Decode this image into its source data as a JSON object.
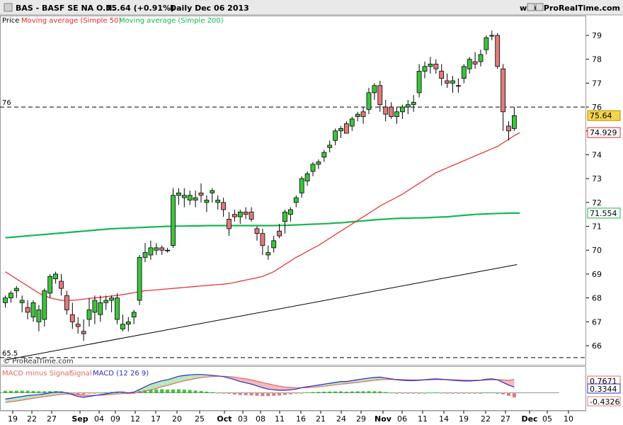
{
  "header": {
    "symbol": "BAS - BASF SE NA O.N.",
    "quote": "75.64 (+0.91%)",
    "period": "Daily  Dec 06 2013",
    "site": "www.ProRealTime.com"
  },
  "legend": {
    "price": "Price",
    "ma50": "Moving average (Simple 50)",
    "ma200": "Moving average (Simple 200)"
  },
  "macd_legend": {
    "hist": "MACD minus Signal",
    "signal": "Signal",
    "macd": "MACD (12 26 9)"
  },
  "copyright": "© ProRealTime.com",
  "colors": {
    "up": "#3cc43c",
    "down": "#e07b7b",
    "ma50": "#e8262a",
    "ma200": "#14b850",
    "macd": "#2a2acc",
    "signal": "#e06a6a",
    "price_tag": "#f6d34a"
  },
  "chart_data": {
    "type": "candlestick",
    "ylim": [
      65.4,
      79.5
    ],
    "y_ticks": [
      "79",
      "78",
      "77",
      "76",
      "75",
      "74",
      "73",
      "72",
      "71",
      "70",
      "69",
      "68",
      "67",
      "66"
    ],
    "x_ticks": [
      "19",
      "22",
      "27",
      "Sep",
      "04",
      "09",
      "12",
      "17",
      "20",
      "25",
      "Oct",
      "03",
      "08",
      "11",
      "16",
      "21",
      "24",
      "29",
      "Nov",
      "06",
      "11",
      "14",
      "19",
      "22",
      "27",
      "Dec",
      "05",
      "10"
    ],
    "h_lines": [
      {
        "label": "76",
        "value": 76.0
      },
      {
        "label": "65.5",
        "value": 65.5
      }
    ],
    "tags": {
      "last": "75.64",
      "ma50": "74.929",
      "ma200": "71.554"
    },
    "candles": [
      [
        67.8,
        68.1,
        67.6,
        68.0
      ],
      [
        68.0,
        68.3,
        67.8,
        68.2
      ],
      [
        68.3,
        68.5,
        68.0,
        68.4
      ],
      [
        67.8,
        68.1,
        67.4,
        67.9
      ],
      [
        67.6,
        67.9,
        67.1,
        67.4
      ],
      [
        67.2,
        67.9,
        67.0,
        67.8
      ],
      [
        67.0,
        67.7,
        66.6,
        67.5
      ],
      [
        67.1,
        68.4,
        66.8,
        68.3
      ],
      [
        68.2,
        69.0,
        68.0,
        68.9
      ],
      [
        68.8,
        69.1,
        68.6,
        69.0
      ],
      [
        68.7,
        69.0,
        68.1,
        68.4
      ],
      [
        68.1,
        68.3,
        67.3,
        67.5
      ],
      [
        67.3,
        67.8,
        66.7,
        67.0
      ],
      [
        66.9,
        67.2,
        66.5,
        66.8
      ],
      [
        66.6,
        67.1,
        66.2,
        66.5
      ],
      [
        67.1,
        68.0,
        66.8,
        67.5
      ],
      [
        67.4,
        68.1,
        66.9,
        67.9
      ],
      [
        67.3,
        68.1,
        67.0,
        67.8
      ],
      [
        67.8,
        68.1,
        67.5,
        67.9
      ],
      [
        67.9,
        68.1,
        67.4,
        68.0
      ],
      [
        67.1,
        68.2,
        66.9,
        68.0
      ],
      [
        66.7,
        67.3,
        66.6,
        66.9
      ],
      [
        66.9,
        67.2,
        66.6,
        67.0
      ],
      [
        67.2,
        67.5,
        66.9,
        67.4
      ],
      [
        67.9,
        69.8,
        67.7,
        69.7
      ],
      [
        69.7,
        70.3,
        69.5,
        69.9
      ],
      [
        69.8,
        70.4,
        69.6,
        70.1
      ],
      [
        70.0,
        70.3,
        69.8,
        70.1
      ],
      [
        70.1,
        70.2,
        69.8,
        70.0
      ],
      [
        70.0,
        70.1,
        69.9,
        70.0
      ],
      [
        70.2,
        72.6,
        70.1,
        72.3
      ],
      [
        72.3,
        72.6,
        71.9,
        72.4
      ],
      [
        72.2,
        72.6,
        71.8,
        72.3
      ],
      [
        72.1,
        72.5,
        71.9,
        72.3
      ],
      [
        72.1,
        72.5,
        71.8,
        72.2
      ],
      [
        72.4,
        72.8,
        72.0,
        72.3
      ],
      [
        72.0,
        72.3,
        71.6,
        72.1
      ],
      [
        72.4,
        72.6,
        72.0,
        72.5
      ],
      [
        72.0,
        72.3,
        71.7,
        72.1
      ],
      [
        72.0,
        72.2,
        71.4,
        71.7
      ],
      [
        71.3,
        71.6,
        70.6,
        70.9
      ],
      [
        71.5,
        71.7,
        71.2,
        71.4
      ],
      [
        71.4,
        71.7,
        71.1,
        71.6
      ],
      [
        71.6,
        71.8,
        71.3,
        71.5
      ],
      [
        71.6,
        71.8,
        71.2,
        71.3
      ],
      [
        70.9,
        71.0,
        70.4,
        70.7
      ],
      [
        70.7,
        70.9,
        69.8,
        70.2
      ],
      [
        69.8,
        70.2,
        69.6,
        69.9
      ],
      [
        70.1,
        70.6,
        69.9,
        70.4
      ],
      [
        70.8,
        71.1,
        70.5,
        70.6
      ],
      [
        71.2,
        71.7,
        70.7,
        71.6
      ],
      [
        71.5,
        71.8,
        71.2,
        71.7
      ],
      [
        72.0,
        72.3,
        71.8,
        72.2
      ],
      [
        72.4,
        73.1,
        72.2,
        73.0
      ],
      [
        72.9,
        73.3,
        72.7,
        73.2
      ],
      [
        73.3,
        73.7,
        73.1,
        73.6
      ],
      [
        73.6,
        73.8,
        73.4,
        73.7
      ],
      [
        73.9,
        74.2,
        73.7,
        74.1
      ],
      [
        74.3,
        74.6,
        74.1,
        74.4
      ],
      [
        74.6,
        75.1,
        74.4,
        75.0
      ],
      [
        75.0,
        75.2,
        74.7,
        75.1
      ],
      [
        75.3,
        75.4,
        74.9,
        74.9
      ],
      [
        75.2,
        75.6,
        75.0,
        75.5
      ],
      [
        75.6,
        75.8,
        75.4,
        75.7
      ],
      [
        75.8,
        76.0,
        75.3,
        75.6
      ],
      [
        75.9,
        76.8,
        75.7,
        76.6
      ],
      [
        76.6,
        77.0,
        76.3,
        76.9
      ],
      [
        76.9,
        77.1,
        75.8,
        76.1
      ],
      [
        76.0,
        76.3,
        75.4,
        75.7
      ],
      [
        76.0,
        76.2,
        75.5,
        75.6
      ],
      [
        75.6,
        76.0,
        75.3,
        75.8
      ],
      [
        75.8,
        76.1,
        75.5,
        76.0
      ],
      [
        76.0,
        76.3,
        75.7,
        76.1
      ],
      [
        76.1,
        76.5,
        75.8,
        76.2
      ],
      [
        76.6,
        77.8,
        76.4,
        77.5
      ],
      [
        77.5,
        77.9,
        77.2,
        77.7
      ],
      [
        77.7,
        78.1,
        77.4,
        77.8
      ],
      [
        77.8,
        78.0,
        77.4,
        77.6
      ],
      [
        77.5,
        77.8,
        76.9,
        77.2
      ],
      [
        77.1,
        77.4,
        76.8,
        77.0
      ],
      [
        77.0,
        77.3,
        76.6,
        77.1
      ],
      [
        76.9,
        77.2,
        76.6,
        76.9
      ],
      [
        77.2,
        77.8,
        77.0,
        77.7
      ],
      [
        77.6,
        78.1,
        77.4,
        78.0
      ],
      [
        77.9,
        78.3,
        77.6,
        77.8
      ],
      [
        77.9,
        78.4,
        77.7,
        78.2
      ],
      [
        78.4,
        79.0,
        78.2,
        78.9
      ],
      [
        79.0,
        79.2,
        78.8,
        79.0
      ],
      [
        79.0,
        79.1,
        77.6,
        77.7
      ],
      [
        77.6,
        77.8,
        75.0,
        75.8
      ],
      [
        75.2,
        75.4,
        74.6,
        75.0
      ],
      [
        75.1,
        76.0,
        75.0,
        75.64
      ]
    ],
    "ma50": [
      69.1,
      68.95,
      68.8,
      68.65,
      68.5,
      68.35,
      68.2,
      68.1,
      68.0,
      67.95,
      67.9,
      67.9,
      67.9,
      67.92,
      67.95,
      67.98,
      68.0,
      68.02,
      68.05,
      68.08,
      68.1,
      68.14,
      68.18,
      68.22,
      68.26,
      68.3,
      68.32,
      68.34,
      68.36,
      68.38,
      68.4,
      68.42,
      68.44,
      68.46,
      68.48,
      68.5,
      68.52,
      68.54,
      68.56,
      68.58,
      68.6,
      68.65,
      68.7,
      68.75,
      68.8,
      68.85,
      68.9,
      69.0,
      69.1,
      69.25,
      69.4,
      69.55,
      69.7,
      69.82,
      69.95,
      70.08,
      70.2,
      70.35,
      70.5,
      70.65,
      70.8,
      70.95,
      71.1,
      71.25,
      71.4,
      71.55,
      71.7,
      71.85,
      71.98,
      72.1,
      72.22,
      72.35,
      72.5,
      72.65,
      72.8,
      72.95,
      73.1,
      73.25,
      73.35,
      73.45,
      73.55,
      73.65,
      73.75,
      73.85,
      73.95,
      74.05,
      74.15,
      74.25,
      74.35,
      74.5,
      74.65,
      74.8,
      74.929
    ],
    "ma200": [
      70.52,
      70.54,
      70.56,
      70.58,
      70.6,
      70.62,
      70.64,
      70.66,
      70.68,
      70.7,
      70.72,
      70.74,
      70.76,
      70.78,
      70.8,
      70.82,
      70.84,
      70.86,
      70.88,
      70.9,
      70.91,
      70.92,
      70.93,
      70.94,
      70.95,
      70.96,
      70.97,
      70.98,
      70.99,
      71.0,
      71.0,
      71.01,
      71.01,
      71.02,
      71.02,
      71.02,
      71.03,
      71.03,
      71.03,
      71.03,
      71.03,
      71.03,
      71.03,
      71.03,
      71.03,
      71.03,
      71.03,
      71.03,
      71.03,
      71.04,
      71.04,
      71.05,
      71.06,
      71.07,
      71.08,
      71.09,
      71.1,
      71.11,
      71.12,
      71.14,
      71.15,
      71.17,
      71.19,
      71.21,
      71.23,
      71.25,
      71.27,
      71.29,
      71.3,
      71.32,
      71.33,
      71.34,
      71.34,
      71.35,
      71.35,
      71.36,
      71.37,
      71.38,
      71.39,
      71.4,
      71.42,
      71.44,
      71.46,
      71.48,
      71.5,
      71.51,
      71.52,
      71.53,
      71.54,
      71.545,
      71.55,
      71.552,
      71.554
    ],
    "trendline": {
      "from": [
        0,
        65.4
      ],
      "to": [
        91.5,
        69.4
      ]
    },
    "macd": {
      "ylim": [
        -0.9,
        1.2
      ],
      "tags": [
        "0.7671",
        "0.3344",
        "-0.4326"
      ],
      "macd": [
        -0.35,
        -0.3,
        -0.25,
        -0.2,
        -0.15,
        -0.12,
        -0.1,
        -0.05,
        0.0,
        0.05,
        0.05,
        0.0,
        -0.1,
        -0.2,
        -0.25,
        -0.2,
        -0.15,
        -0.1,
        -0.05,
        0.0,
        0.05,
        0.05,
        0.0,
        0.05,
        0.2,
        0.35,
        0.5,
        0.6,
        0.7,
        0.75,
        0.85,
        0.95,
        1.0,
        1.03,
        1.05,
        1.05,
        1.03,
        1.0,
        0.97,
        0.93,
        0.85,
        0.75,
        0.65,
        0.58,
        0.5,
        0.4,
        0.3,
        0.22,
        0.18,
        0.15,
        0.15,
        0.18,
        0.22,
        0.3,
        0.35,
        0.4,
        0.45,
        0.5,
        0.55,
        0.6,
        0.65,
        0.65,
        0.7,
        0.75,
        0.8,
        0.85,
        0.88,
        0.9,
        0.85,
        0.8,
        0.75,
        0.72,
        0.7,
        0.7,
        0.72,
        0.75,
        0.78,
        0.8,
        0.78,
        0.75,
        0.72,
        0.7,
        0.68,
        0.68,
        0.7,
        0.72,
        0.78,
        0.8,
        0.75,
        0.6,
        0.45,
        0.3344
      ],
      "signal": [
        -0.55,
        -0.5,
        -0.46,
        -0.41,
        -0.36,
        -0.3,
        -0.26,
        -0.21,
        -0.17,
        -0.12,
        -0.09,
        -0.06,
        -0.07,
        -0.09,
        -0.12,
        -0.14,
        -0.14,
        -0.13,
        -0.11,
        -0.09,
        -0.06,
        -0.04,
        -0.03,
        -0.01,
        0.03,
        0.1,
        0.18,
        0.26,
        0.35,
        0.43,
        0.52,
        0.61,
        0.69,
        0.75,
        0.82,
        0.87,
        0.91,
        0.93,
        0.95,
        0.95,
        0.93,
        0.9,
        0.85,
        0.8,
        0.74,
        0.67,
        0.6,
        0.52,
        0.45,
        0.39,
        0.34,
        0.31,
        0.29,
        0.29,
        0.3,
        0.32,
        0.35,
        0.38,
        0.42,
        0.46,
        0.5,
        0.53,
        0.56,
        0.6,
        0.64,
        0.68,
        0.72,
        0.75,
        0.77,
        0.77,
        0.77,
        0.76,
        0.75,
        0.74,
        0.74,
        0.74,
        0.75,
        0.76,
        0.76,
        0.76,
        0.75,
        0.74,
        0.73,
        0.72,
        0.72,
        0.72,
        0.73,
        0.75,
        0.75,
        0.74,
        0.72,
        0.7671
      ]
    }
  }
}
